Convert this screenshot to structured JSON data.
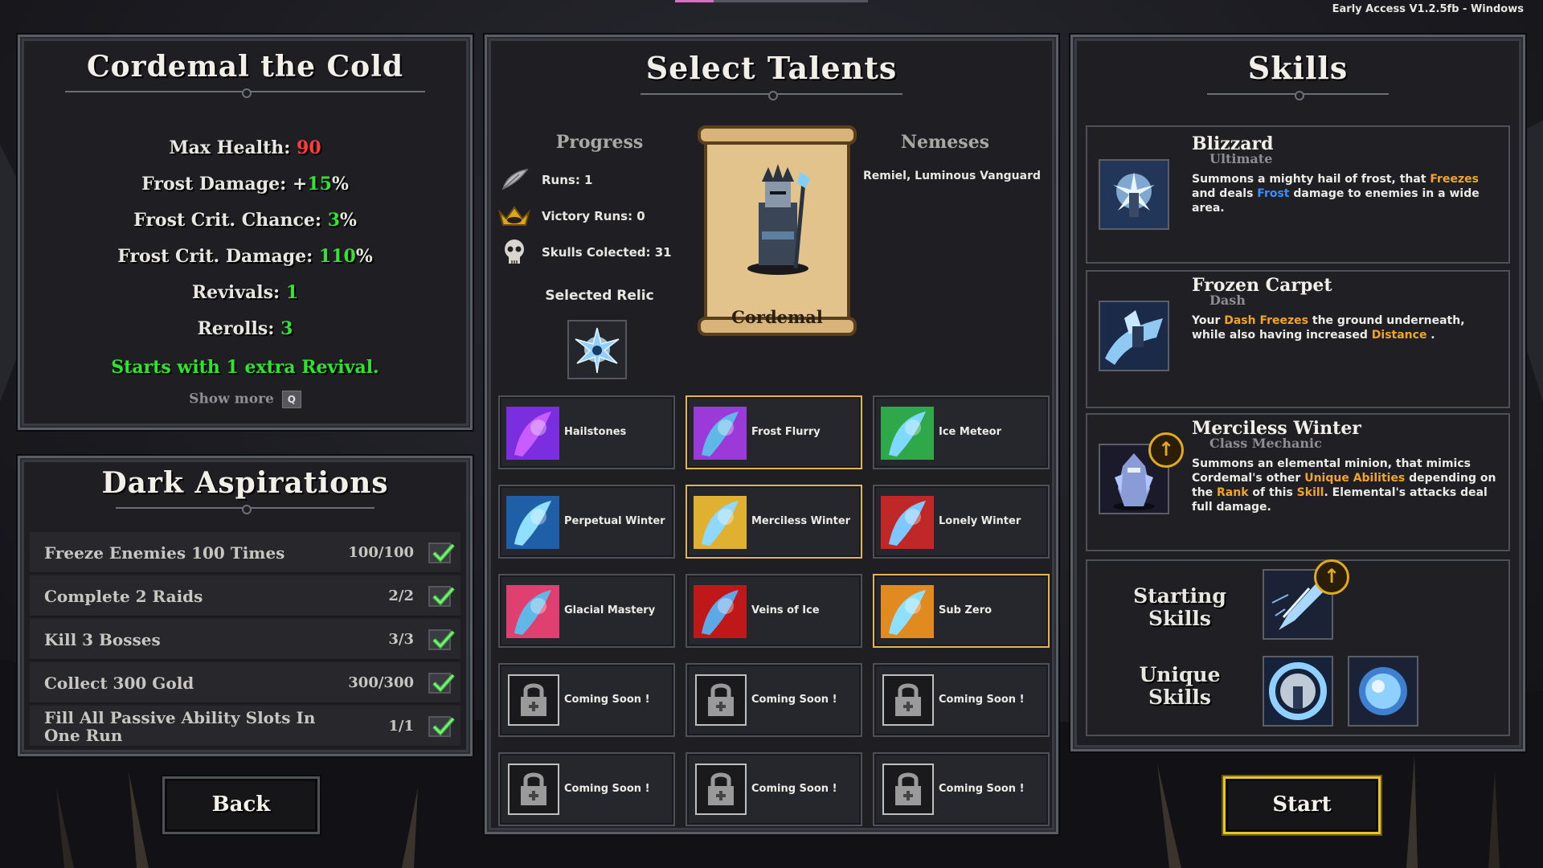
{
  "version": "Early Access V1.2.5fb - Windows",
  "character": {
    "name": "Cordemal the Cold",
    "stats": [
      {
        "label": "Max Health:",
        "value": "90",
        "suffix": "",
        "color": "red"
      },
      {
        "label": "Frost Damage: +",
        "value": "15",
        "suffix": "%",
        "color": "green"
      },
      {
        "label": "Frost Crit. Chance:",
        "value": "3",
        "suffix": "%",
        "color": "green"
      },
      {
        "label": "Frost Crit. Damage:",
        "value": "110",
        "suffix": "%",
        "color": "green"
      },
      {
        "label": "Revivals:",
        "value": "1",
        "suffix": "",
        "color": "green"
      },
      {
        "label": "Rerolls:",
        "value": "3",
        "suffix": "",
        "color": "green"
      }
    ],
    "bonus": "Starts with 1 extra Revival.",
    "show_more": "Show more",
    "show_more_key": "Q"
  },
  "aspirations": {
    "title": "Dark Aspirations",
    "items": [
      {
        "name": "Freeze Enemies 100 Times",
        "count": "100/100",
        "done": true
      },
      {
        "name": "Complete 2 Raids",
        "count": "2/2",
        "done": true
      },
      {
        "name": "Kill 3 Bosses",
        "count": "3/3",
        "done": true
      },
      {
        "name": "Collect 300 Gold",
        "count": "300/300",
        "done": true
      },
      {
        "name": "Fill All Passive Ability Slots In One Run",
        "count": "1/1",
        "done": true
      }
    ]
  },
  "buttons": {
    "back": "Back",
    "start": "Start"
  },
  "talents": {
    "title": "Select Talents",
    "progress_head": "Progress",
    "nemeses_head": "Nemeses",
    "progress": [
      {
        "icon": "feather-icon",
        "text": "Runs: 1"
      },
      {
        "icon": "crown-icon",
        "text": "Victory Runs: 0"
      },
      {
        "icon": "skull-icon",
        "text": "Skulls Colected: 31"
      }
    ],
    "nemesis": "Remiel, Luminous Vanguard",
    "selected_relic_label": "Selected Relic",
    "portrait_name": "Cordemal",
    "grid": [
      {
        "name": "Hailstones",
        "selected": false,
        "locked": false,
        "c1": "#7a2ee0",
        "c2": "#c85cff"
      },
      {
        "name": "Frost Flurry",
        "selected": true,
        "locked": false,
        "c1": "#9b3ad8",
        "c2": "#5fb8e8"
      },
      {
        "name": "Ice Meteor",
        "selected": false,
        "locked": false,
        "c1": "#2fa84a",
        "c2": "#7fd8ff"
      },
      {
        "name": "Perpetual Winter",
        "selected": false,
        "locked": false,
        "c1": "#1f5fa8",
        "c2": "#8fe0ff"
      },
      {
        "name": "Merciless Winter",
        "selected": true,
        "locked": false,
        "c1": "#e0b030",
        "c2": "#8fd8ff"
      },
      {
        "name": "Lonely Winter",
        "selected": false,
        "locked": false,
        "c1": "#c02828",
        "c2": "#7fc8ff"
      },
      {
        "name": "Glacial Mastery",
        "selected": false,
        "locked": false,
        "c1": "#e04070",
        "c2": "#5fb8e8"
      },
      {
        "name": "Veins of Ice",
        "selected": false,
        "locked": false,
        "c1": "#c01818",
        "c2": "#5fa8e8"
      },
      {
        "name": "Sub Zero",
        "selected": true,
        "locked": false,
        "c1": "#e08a20",
        "c2": "#8fe0ff"
      },
      {
        "name": "Coming Soon !",
        "selected": false,
        "locked": true
      },
      {
        "name": "Coming Soon !",
        "selected": false,
        "locked": true
      },
      {
        "name": "Coming Soon !",
        "selected": false,
        "locked": true
      },
      {
        "name": "Coming Soon !",
        "selected": false,
        "locked": true
      },
      {
        "name": "Coming Soon !",
        "selected": false,
        "locked": true
      },
      {
        "name": "Coming Soon !",
        "selected": false,
        "locked": true
      }
    ]
  },
  "skills": {
    "title": "Skills",
    "cards": [
      {
        "name": "Blizzard",
        "type": "Ultimate",
        "desc": [
          {
            "t": "Summons a mighty hail of frost, that ",
            "c": ""
          },
          {
            "t": "Freezes",
            "c": "orange"
          },
          {
            "t": " and deals ",
            "c": ""
          },
          {
            "t": "Frost",
            "c": "blue"
          },
          {
            "t": " damage to enemies in a wide area.",
            "c": ""
          }
        ]
      },
      {
        "name": "Frozen Carpet",
        "type": "Dash",
        "desc": [
          {
            "t": "Your ",
            "c": ""
          },
          {
            "t": "Dash",
            "c": "orange"
          },
          {
            "t": " ",
            "c": ""
          },
          {
            "t": "Freezes",
            "c": "orange"
          },
          {
            "t": " the ground underneath, while also having increased ",
            "c": ""
          },
          {
            "t": "Distance",
            "c": "orange"
          },
          {
            "t": " .",
            "c": ""
          }
        ]
      },
      {
        "name": "Merciless Winter",
        "type": "Class Mechanic",
        "desc": [
          {
            "t": "Summons an elemental minion, that mimics Cordemal's other ",
            "c": ""
          },
          {
            "t": "Unique Abilities",
            "c": "orange"
          },
          {
            "t": " depending on the ",
            "c": ""
          },
          {
            "t": "Rank",
            "c": "orange"
          },
          {
            "t": " of this ",
            "c": ""
          },
          {
            "t": "Skill",
            "c": "orange"
          },
          {
            "t": ". Elemental's attacks deal full damage.",
            "c": ""
          }
        ]
      }
    ],
    "starting_label": "Starting Skills",
    "unique_label": "Unique Skills"
  }
}
